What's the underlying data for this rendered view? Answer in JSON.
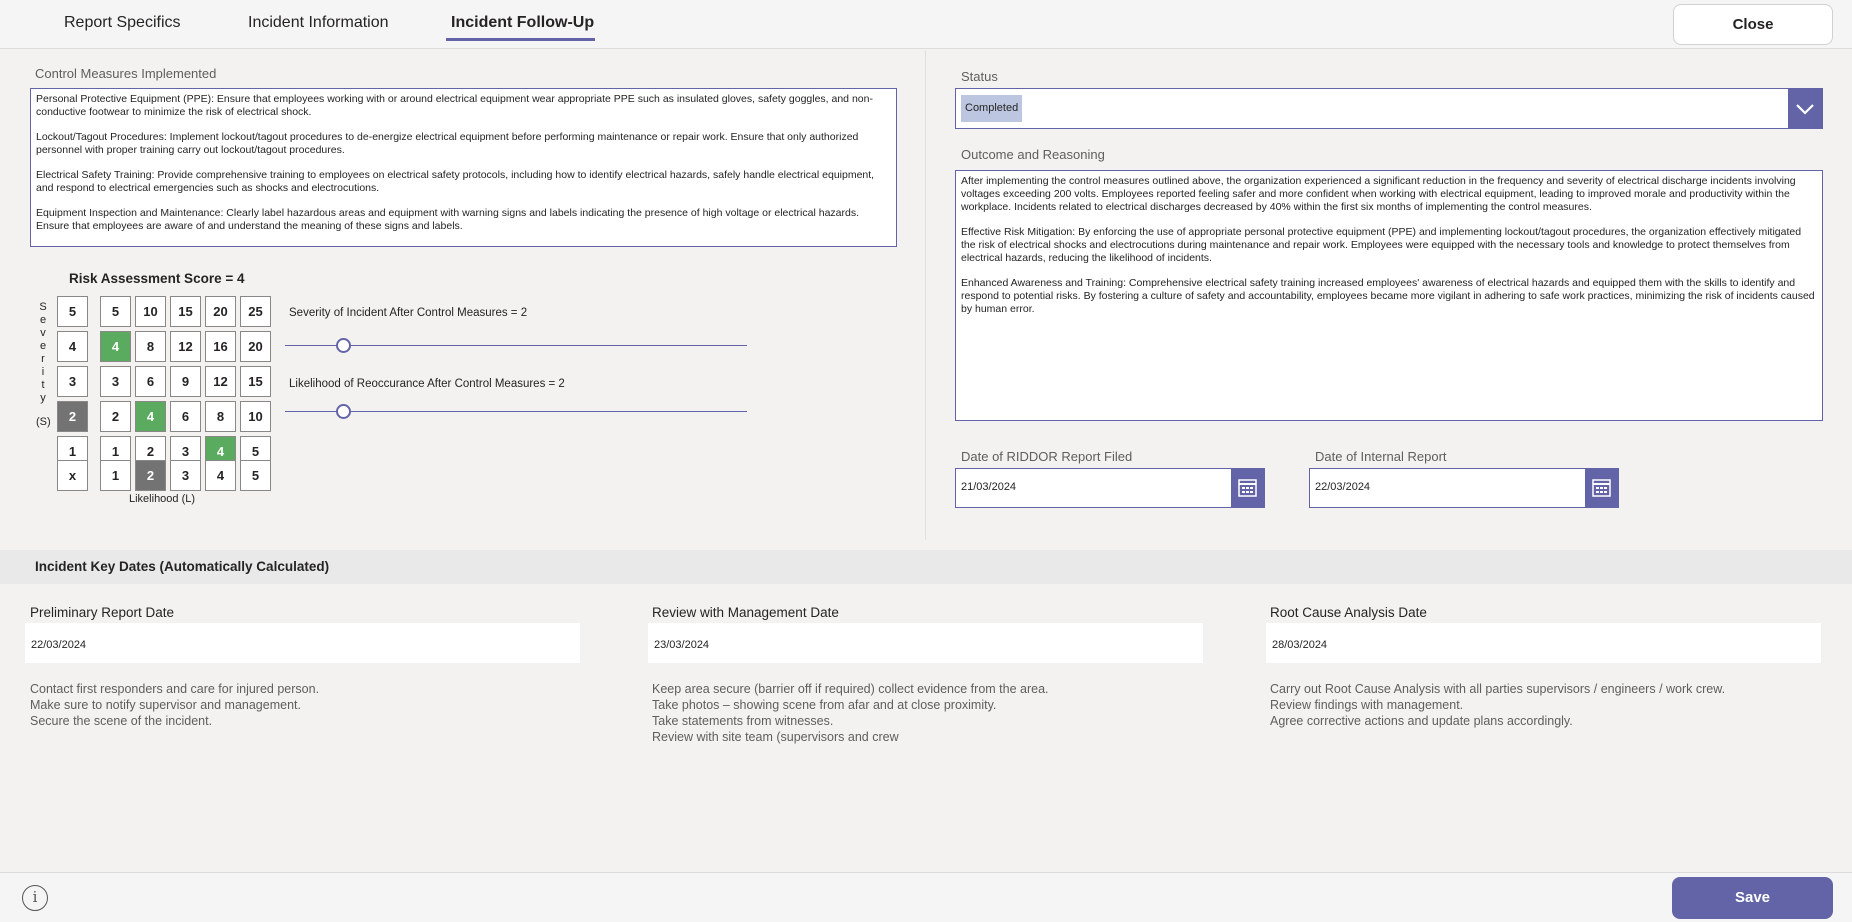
{
  "tabs": [
    {
      "label": "Report Specifics"
    },
    {
      "label": "Incident Information"
    },
    {
      "label": "Incident Follow-Up"
    }
  ],
  "header": {
    "close_label": "Close"
  },
  "control_measures": {
    "label": "Control Measures Implemented",
    "paragraphs": [
      "Personal Protective Equipment (PPE): Ensure that employees working with or around electrical equipment wear appropriate PPE such as insulated gloves, safety goggles, and non-conductive footwear to minimize the risk of electrical shock.",
      "Lockout/Tagout Procedures: Implement lockout/tagout procedures to de-energize electrical equipment before performing maintenance or repair work. Ensure that only authorized personnel with proper training carry out lockout/tagout procedures.",
      "Electrical Safety Training: Provide comprehensive training to employees on electrical safety protocols, including how to identify electrical hazards, safely handle electrical equipment, and respond to electrical emergencies such as shocks and electrocutions.",
      "Equipment Inspection and Maintenance: Clearly label hazardous areas and equipment with warning signs and labels indicating the presence of high voltage or electrical hazards. Ensure that employees are aware of and understand the meaning of these signs and labels."
    ]
  },
  "risk": {
    "title": "Risk Assessment Score = 4",
    "severity_letters": [
      "S",
      "e",
      "v",
      "e",
      "r",
      "i",
      "t",
      "y"
    ],
    "severity_suffix": "(S)",
    "severity_levels": [
      "5",
      "4",
      "3",
      "2",
      "1"
    ],
    "matrix": [
      [
        "5",
        "10",
        "15",
        "20",
        "25"
      ],
      [
        "4",
        "8",
        "12",
        "16",
        "20"
      ],
      [
        "3",
        "6",
        "9",
        "12",
        "15"
      ],
      [
        "2",
        "4",
        "6",
        "8",
        "10"
      ],
      [
        "1",
        "2",
        "3",
        "4",
        "5"
      ]
    ],
    "x_label": "x",
    "likelihood_levels": [
      "1",
      "2",
      "3",
      "4",
      "5"
    ],
    "likelihood_label": "Likelihood (L)",
    "selected_severity": "2",
    "selected_likelihood": "2",
    "highlight_color": "#5aab5f",
    "selected_color": "#737373",
    "severity_slider": {
      "label": "Severity of Incident After Control Measures = 2",
      "value": 2,
      "min": 1,
      "max": 5
    },
    "likelihood_slider": {
      "label": "Likelihood of Reoccurance After Control Measures = 2",
      "value": 2,
      "min": 1,
      "max": 5
    }
  },
  "status": {
    "label": "Status",
    "value": "Completed",
    "icon": "chevron-down-icon"
  },
  "outcome": {
    "label": "Outcome and Reasoning",
    "paragraphs": [
      "After implementing the control measures outlined above, the organization experienced a significant reduction in the frequency and severity of electrical discharge incidents involving voltages exceeding 200 volts. Employees reported feeling safer and more confident when working with electrical equipment, leading to improved morale and productivity within the workplace. Incidents related to electrical discharges decreased by 40% within the first six months of implementing the control measures.",
      "Effective Risk Mitigation: By enforcing the use of appropriate personal protective equipment (PPE) and implementing lockout/tagout procedures, the organization effectively mitigated the risk of electrical shocks and electrocutions during maintenance and repair work. Employees were equipped with the necessary tools and knowledge to protect themselves from electrical hazards, reducing the likelihood of incidents.",
      "Enhanced Awareness and Training: Comprehensive electrical safety training increased employees' awareness of electrical hazards and equipped them with the skills to identify and respond to potential risks. By fostering a culture of safety and accountability, employees became more vigilant in adhering to safe work practices, minimizing the risk of incidents caused by human error."
    ]
  },
  "riddor_date": {
    "label": "Date of RIDDOR Report Filed",
    "value": "21/03/2024"
  },
  "internal_date": {
    "label": "Date of Internal Report",
    "value": "22/03/2024"
  },
  "key_dates": {
    "title": "Incident Key Dates (Automatically Calculated)",
    "items": [
      {
        "label": "Preliminary Report Date",
        "value": "22/03/2024",
        "notes": [
          "Contact first responders and care for injured person.",
          "Make sure to notify supervisor and management.",
          "Secure the scene of the incident."
        ]
      },
      {
        "label": "Review with Management Date",
        "value": "23/03/2024",
        "notes": [
          "Keep area secure (barrier off if required) collect evidence from the area.",
          "Take photos – showing scene from afar and at close proximity.",
          "Take statements from witnesses.",
          "Review with site team (supervisors and crew"
        ]
      },
      {
        "label": "Root Cause Analysis Date",
        "value": "28/03/2024",
        "notes": [
          "Carry out Root Cause Analysis with all parties supervisors / engineers / work crew.",
          "Review findings with management.",
          "Agree corrective actions and update plans accordingly."
        ]
      }
    ]
  },
  "footer": {
    "info_icon": "i",
    "save_label": "Save"
  },
  "colors": {
    "accent": "#6264a7"
  }
}
